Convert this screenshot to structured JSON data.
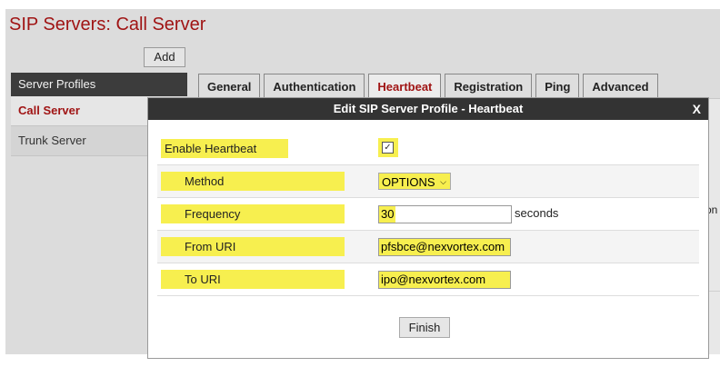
{
  "page": {
    "title": "SIP Servers: Call Server",
    "add_label": "Add"
  },
  "sidebar": {
    "header": "Server Profiles",
    "items": [
      {
        "label": "Call Server"
      },
      {
        "label": "Trunk Server"
      }
    ]
  },
  "tabs": [
    {
      "label": "General"
    },
    {
      "label": "Authentication"
    },
    {
      "label": "Heartbeat"
    },
    {
      "label": "Registration"
    },
    {
      "label": "Ping"
    },
    {
      "label": "Advanced"
    }
  ],
  "active_tab": "Heartbeat",
  "background_overflow_text": "on",
  "modal": {
    "title": "Edit SIP Server Profile - Heartbeat",
    "close_label": "X",
    "enable_heartbeat": {
      "label": "Enable Heartbeat",
      "checked": true,
      "check_glyph": "✓"
    },
    "method": {
      "label": "Method",
      "value": "OPTIONS",
      "arrow": "⌵"
    },
    "frequency": {
      "label": "Frequency",
      "value": "30",
      "suffix": "seconds"
    },
    "from_uri": {
      "label": "From URI",
      "value": "pfsbce@nexvortex.com"
    },
    "to_uri": {
      "label": "To URI",
      "value": "ipo@nexvortex.com"
    },
    "finish_label": "Finish"
  },
  "colors": {
    "accent": "#a01414",
    "highlight": "#f7ef4f",
    "header_bg": "#333333"
  }
}
